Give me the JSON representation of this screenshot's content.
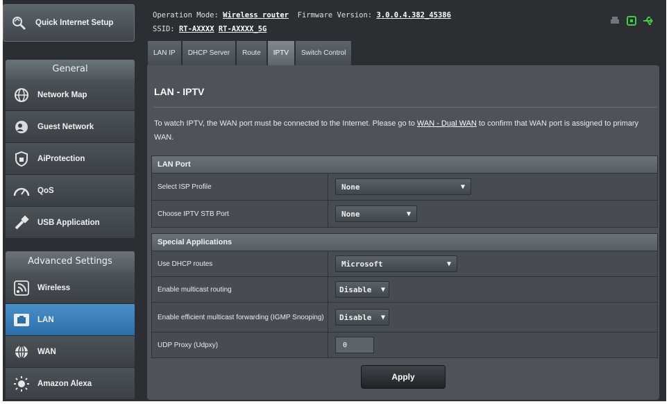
{
  "sidebar": {
    "quick_setup_label": "Quick Internet Setup",
    "general_header": "General",
    "general_items": [
      {
        "label": "Network Map",
        "icon": "network-map-icon"
      },
      {
        "label": "Guest Network",
        "icon": "guest-network-icon"
      },
      {
        "label": "AiProtection",
        "icon": "shield-icon"
      },
      {
        "label": "QoS",
        "icon": "gauge-icon"
      },
      {
        "label": "USB Application",
        "icon": "usb-icon"
      }
    ],
    "advanced_header": "Advanced Settings",
    "advanced_items": [
      {
        "label": "Wireless",
        "icon": "wireless-icon"
      },
      {
        "label": "LAN",
        "icon": "lan-icon",
        "active": true
      },
      {
        "label": "WAN",
        "icon": "globe-icon"
      },
      {
        "label": "Amazon Alexa",
        "icon": "alexa-icon"
      }
    ]
  },
  "header": {
    "op_mode_label": "Operation Mode:",
    "op_mode_value": "Wireless router",
    "fw_label": "Firmware Version:",
    "fw_value": "3.0.0.4.382_45386",
    "ssid_label": "SSID:",
    "ssid_1": "RT-AXXXX",
    "ssid_2": "RT-AXXXX_5G"
  },
  "tabs": [
    {
      "label": "LAN IP"
    },
    {
      "label": "DHCP Server"
    },
    {
      "label": "Route"
    },
    {
      "label": "IPTV",
      "active": true
    },
    {
      "label": "Switch Control"
    }
  ],
  "page": {
    "title": "LAN - IPTV",
    "desc_before": "To watch IPTV, the WAN port must be connected to the Internet. Please go to ",
    "desc_link": "WAN - Dual WAN",
    "desc_after": " to confirm that WAN port is assigned to primary WAN."
  },
  "lan_port": {
    "header": "LAN Port",
    "isp_profile_label": "Select ISP Profile",
    "isp_profile_value": "None",
    "stb_port_label": "Choose IPTV STB Port",
    "stb_port_value": "None"
  },
  "special_apps": {
    "header": "Special Applications",
    "dhcp_routes_label": "Use DHCP routes",
    "dhcp_routes_value": "Microsoft",
    "multicast_label": "Enable multicast routing",
    "multicast_value": "Disable",
    "igmp_label": "Enable efficient multicast forwarding (IGMP Snooping)",
    "igmp_value": "Disable",
    "udpxy_label": "UDP Proxy (Udpxy)",
    "udpxy_value": "0"
  },
  "apply_label": "Apply",
  "colors": {
    "accent": "#2b6ea8",
    "panel": "#4d5358",
    "background": "#2b2f33"
  }
}
